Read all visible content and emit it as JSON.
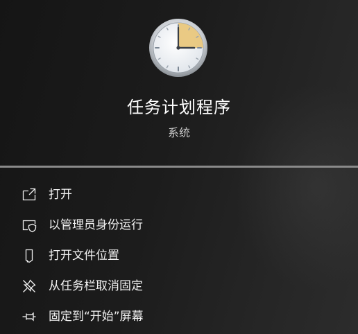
{
  "app": {
    "name": "任务计划程序",
    "category": "系统"
  },
  "menu": {
    "items": [
      {
        "label": "打开",
        "icon": "open-external-icon"
      },
      {
        "label": "以管理员身份运行",
        "icon": "shield-admin-icon"
      },
      {
        "label": "打开文件位置",
        "icon": "file-location-icon"
      },
      {
        "label": "从任务栏取消固定",
        "icon": "unpin-icon"
      },
      {
        "label": "固定到“开始”屏幕",
        "icon": "pin-icon"
      }
    ]
  },
  "colors": {
    "background": "#1b1b1b",
    "text": "#f2f2f2",
    "secondary_text": "#c8c8c8",
    "divider": "#8a8a8a",
    "clock_face": "#f3f5f7",
    "clock_highlight": "#e9c77d"
  }
}
